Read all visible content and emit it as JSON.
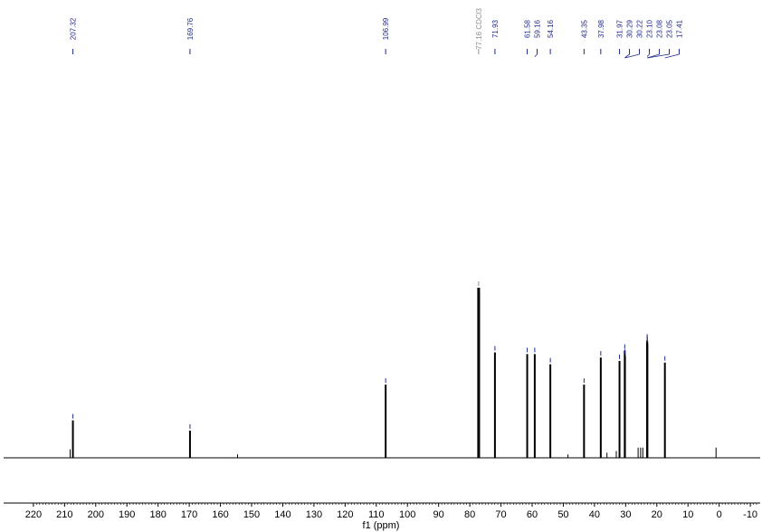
{
  "chart_data": {
    "type": "line",
    "title": "",
    "xlabel": "f1 (ppm)",
    "ylabel": "",
    "x_reversed": true,
    "xlim": [
      222,
      -12
    ],
    "ylim": [
      0,
      1
    ],
    "x_ticks": [
      220,
      210,
      200,
      190,
      180,
      170,
      160,
      150,
      140,
      130,
      120,
      110,
      100,
      90,
      80,
      70,
      60,
      50,
      40,
      30,
      20,
      10,
      0,
      -10
    ],
    "grid": false,
    "legend": "none",
    "peak_color": "#1f2a8a",
    "solvent_color": "#8f8f8f",
    "line_color": "#000000",
    "peaks": [
      {
        "ppm": 207.32,
        "intensity": 0.22,
        "label": "207.32"
      },
      {
        "ppm": 169.76,
        "intensity": 0.16,
        "label": "169.76"
      },
      {
        "ppm": 106.99,
        "intensity": 0.43,
        "label": "106.99"
      },
      {
        "ppm": 77.16,
        "intensity": 1.0,
        "label": "77.16 CDCl3",
        "solvent": true
      },
      {
        "ppm": 71.93,
        "intensity": 0.62,
        "label": "71.93"
      },
      {
        "ppm": 61.58,
        "intensity": 0.61,
        "label": "61.58"
      },
      {
        "ppm": 59.16,
        "intensity": 0.61,
        "label": "59.16"
      },
      {
        "ppm": 54.16,
        "intensity": 0.55,
        "label": "54.16"
      },
      {
        "ppm": 43.35,
        "intensity": 0.43,
        "label": "43.35"
      },
      {
        "ppm": 37.98,
        "intensity": 0.59,
        "label": "37.98"
      },
      {
        "ppm": 31.97,
        "intensity": 0.57,
        "label": "31.97"
      },
      {
        "ppm": 30.29,
        "intensity": 0.63,
        "label": "30.29"
      },
      {
        "ppm": 30.22,
        "intensity": 0.6,
        "label": "30.22"
      },
      {
        "ppm": 23.1,
        "intensity": 0.69,
        "label": "23.10"
      },
      {
        "ppm": 23.08,
        "intensity": 0.68,
        "label": "23.08"
      },
      {
        "ppm": 23.05,
        "intensity": 0.67,
        "label": "23.05"
      },
      {
        "ppm": 17.41,
        "intensity": 0.56,
        "label": "17.41"
      }
    ],
    "minor_peaks": [
      {
        "ppm": 208.2,
        "intensity": 0.05
      },
      {
        "ppm": 154.5,
        "intensity": 0.02
      },
      {
        "ppm": 76.9,
        "intensity": 0.97
      },
      {
        "ppm": 77.4,
        "intensity": 0.97
      },
      {
        "ppm": 48.5,
        "intensity": 0.02
      },
      {
        "ppm": 36.0,
        "intensity": 0.03
      },
      {
        "ppm": 33.0,
        "intensity": 0.04
      },
      {
        "ppm": 26.0,
        "intensity": 0.06
      },
      {
        "ppm": 25.2,
        "intensity": 0.06
      },
      {
        "ppm": 24.5,
        "intensity": 0.06
      },
      {
        "ppm": 1.0,
        "intensity": 0.06
      }
    ]
  }
}
